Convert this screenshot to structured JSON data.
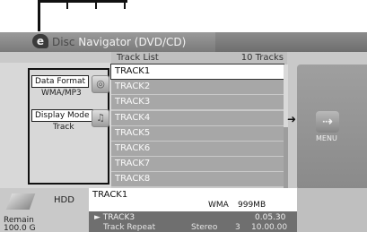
{
  "window": {
    "title_brand": "Disc",
    "title_rest": " Navigator (DVD/CD)"
  },
  "track_list": {
    "header": "Track List",
    "count": "10 Tracks",
    "tracks": [
      "TRACK1",
      "TRACK2",
      "TRACK3",
      "TRACK4",
      "TRACK5",
      "TRACK6",
      "TRACK7",
      "TRACK8"
    ],
    "selected_index": 0
  },
  "info_panel": {
    "data_format_label": "Data Format",
    "data_format_value": "WMA/MP3",
    "display_mode_label": "Display Mode",
    "display_mode_value": "Track"
  },
  "menu": {
    "label": "MENU"
  },
  "bottom": {
    "hdd_label": "HDD",
    "remain_label": "Remain",
    "remain_value": "100.0 G",
    "info_track": "TRACK1",
    "info_format": "WMA",
    "info_size": "999MB",
    "playing_track": "► TRACK3",
    "playing_time": "0.05.30",
    "repeat_label": "Track Repeat",
    "audio_mode": "Stereo",
    "channel": "3",
    "total_time": "10.00.00"
  },
  "colors": {
    "header_bg": "#7a7a7a",
    "track_row_bg": "#a7a7a7",
    "selected_row_bg": "#ffffff",
    "menu_panel_bg": "#959595"
  },
  "icons": {
    "logo": "disc-navigator-logo-icon",
    "disc": "disc-icon",
    "music": "music-note-icon",
    "menu": "menu-arrow-icon",
    "hdd": "hdd-icon"
  }
}
